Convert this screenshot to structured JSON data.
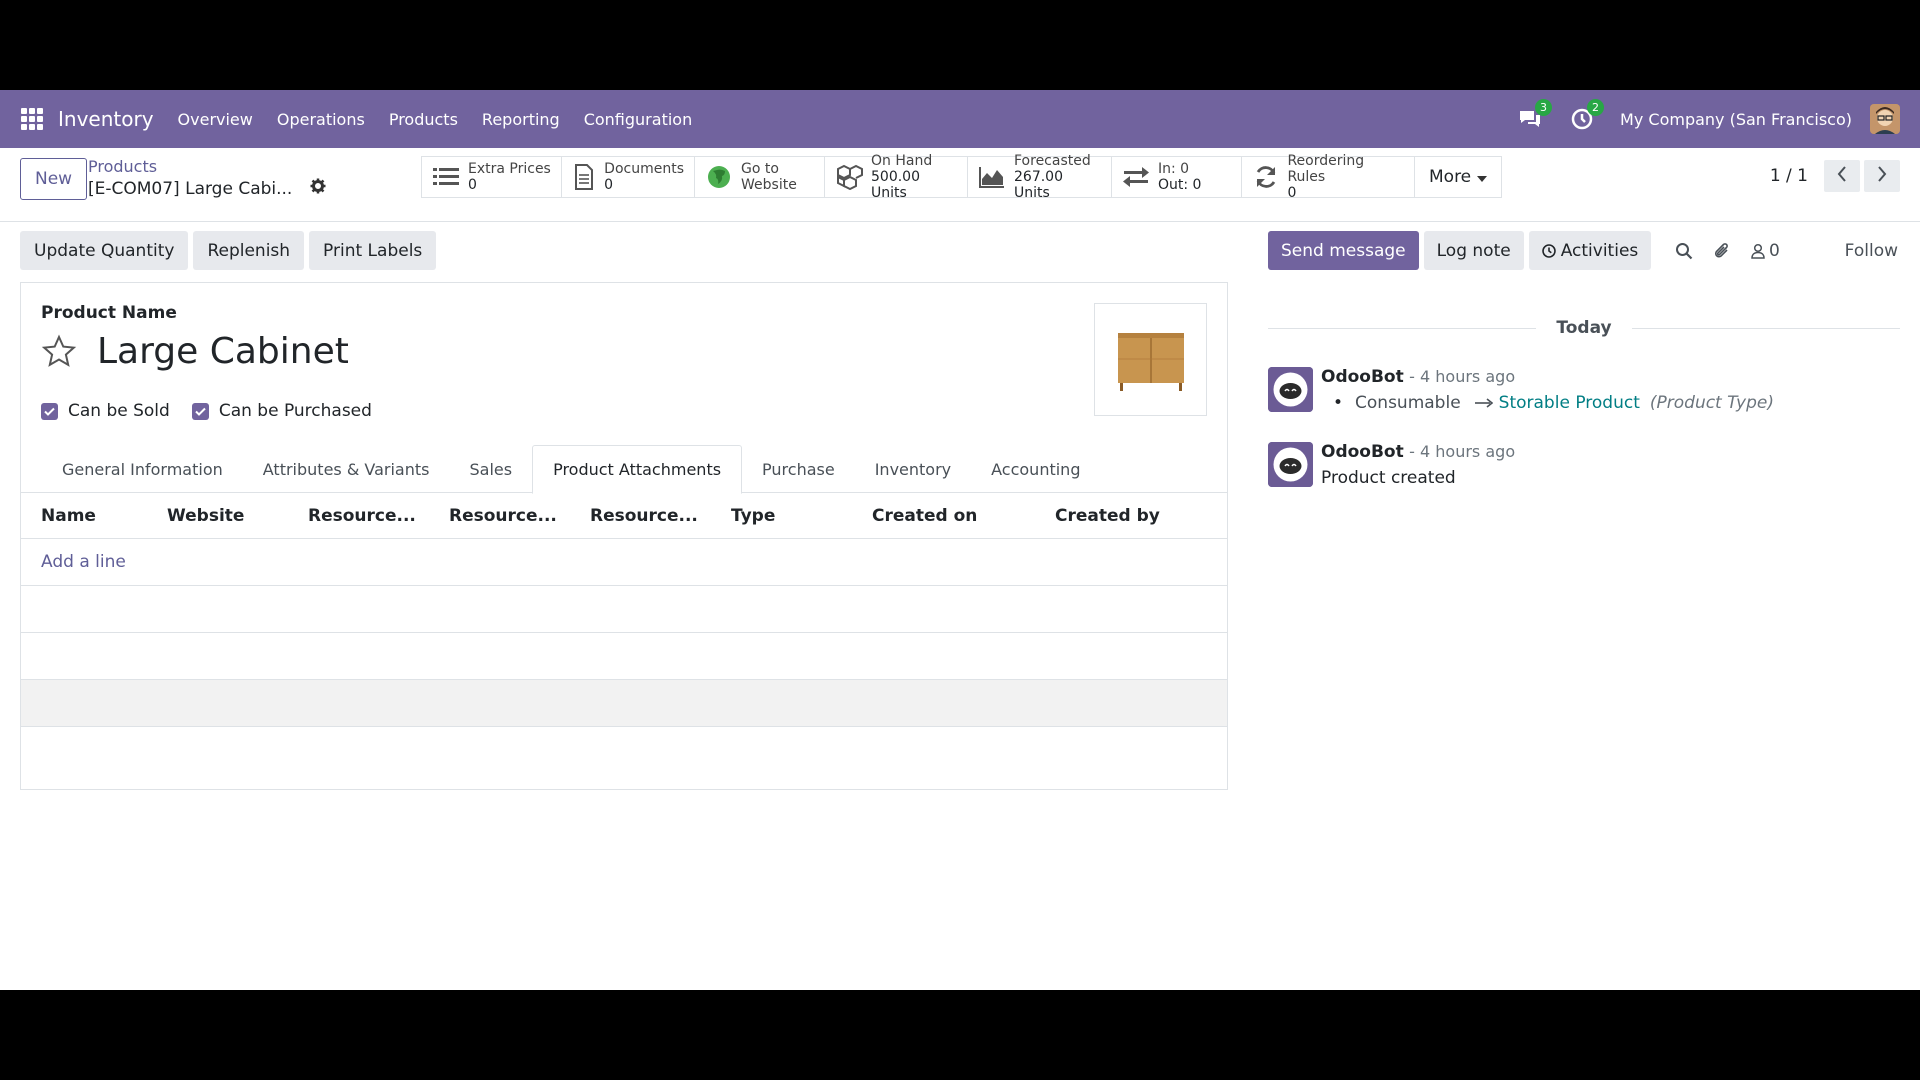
{
  "navbar": {
    "app_name": "Inventory",
    "menu": [
      "Overview",
      "Operations",
      "Products",
      "Reporting",
      "Configuration"
    ],
    "messages_badge": "3",
    "activities_badge": "2",
    "company": "My Company (San Francisco)"
  },
  "control": {
    "new_label": "New",
    "breadcrumb_parent": "Products",
    "breadcrumb_current": "[E-COM07] Large Cabi...",
    "smart_buttons": [
      {
        "icon": "list-icon",
        "label": "Extra Prices",
        "value": "0"
      },
      {
        "icon": "document-icon",
        "label": "Documents",
        "value": "0"
      },
      {
        "icon": "globe-icon",
        "label": "Go to",
        "value": "Website"
      },
      {
        "icon": "cubes-icon",
        "label": "On Hand",
        "value": "500.00 Units"
      },
      {
        "icon": "area-chart-icon",
        "label": "Forecasted",
        "value": "267.00 Units"
      },
      {
        "icon": "exchange-icon",
        "label": "In: 0",
        "value": "Out: 0"
      },
      {
        "icon": "refresh-icon",
        "label": "Reordering Rules",
        "value": "0"
      }
    ],
    "more_label": "More",
    "pager": "1 / 1"
  },
  "actions": {
    "update_quantity": "Update Quantity",
    "replenish": "Replenish",
    "print_labels": "Print Labels"
  },
  "form": {
    "product_name_label": "Product Name",
    "product_name": "Large Cabinet",
    "can_be_sold": "Can be Sold",
    "can_be_purchased": "Can be Purchased",
    "tabs": [
      "General Information",
      "Attributes & Variants",
      "Sales",
      "Product Attachments",
      "Purchase",
      "Inventory",
      "Accounting"
    ],
    "active_tab": "Product Attachments",
    "table_headers": [
      "Name",
      "Website",
      "Resource...",
      "Resource...",
      "Resource...",
      "Type",
      "Created on",
      "Created by"
    ],
    "add_line": "Add a line"
  },
  "chatter": {
    "send_message": "Send message",
    "log_note": "Log note",
    "activities": "Activities",
    "followers_count": "0",
    "follow": "Follow",
    "today": "Today",
    "messages": [
      {
        "author": "OdooBot",
        "date": "- 4 hours ago",
        "old_value": "Consumable",
        "new_value": "Storable Product",
        "field": "(Product Type)"
      },
      {
        "author": "OdooBot",
        "date": "- 4 hours ago",
        "body": "Product created"
      }
    ]
  },
  "colors": {
    "brand": "#71639e",
    "link": "#017e84",
    "badge": "#28a745"
  }
}
